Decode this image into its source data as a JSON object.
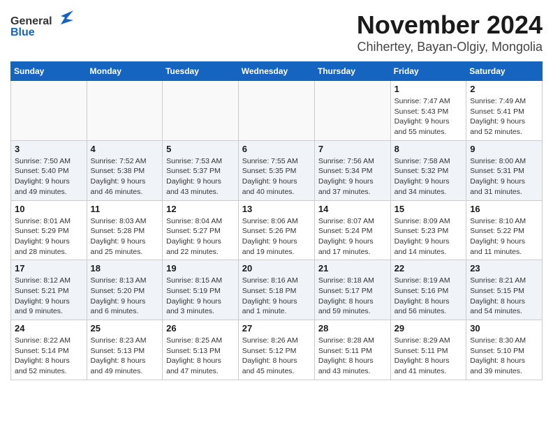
{
  "header": {
    "logo_general": "General",
    "logo_blue": "Blue",
    "month_title": "November 2024",
    "location": "Chihertey, Bayan-Olgiy, Mongolia"
  },
  "weekdays": [
    "Sunday",
    "Monday",
    "Tuesday",
    "Wednesday",
    "Thursday",
    "Friday",
    "Saturday"
  ],
  "weeks": [
    [
      {
        "day": "",
        "info": ""
      },
      {
        "day": "",
        "info": ""
      },
      {
        "day": "",
        "info": ""
      },
      {
        "day": "",
        "info": ""
      },
      {
        "day": "",
        "info": ""
      },
      {
        "day": "1",
        "info": "Sunrise: 7:47 AM\nSunset: 5:43 PM\nDaylight: 9 hours\nand 55 minutes."
      },
      {
        "day": "2",
        "info": "Sunrise: 7:49 AM\nSunset: 5:41 PM\nDaylight: 9 hours\nand 52 minutes."
      }
    ],
    [
      {
        "day": "3",
        "info": "Sunrise: 7:50 AM\nSunset: 5:40 PM\nDaylight: 9 hours\nand 49 minutes."
      },
      {
        "day": "4",
        "info": "Sunrise: 7:52 AM\nSunset: 5:38 PM\nDaylight: 9 hours\nand 46 minutes."
      },
      {
        "day": "5",
        "info": "Sunrise: 7:53 AM\nSunset: 5:37 PM\nDaylight: 9 hours\nand 43 minutes."
      },
      {
        "day": "6",
        "info": "Sunrise: 7:55 AM\nSunset: 5:35 PM\nDaylight: 9 hours\nand 40 minutes."
      },
      {
        "day": "7",
        "info": "Sunrise: 7:56 AM\nSunset: 5:34 PM\nDaylight: 9 hours\nand 37 minutes."
      },
      {
        "day": "8",
        "info": "Sunrise: 7:58 AM\nSunset: 5:32 PM\nDaylight: 9 hours\nand 34 minutes."
      },
      {
        "day": "9",
        "info": "Sunrise: 8:00 AM\nSunset: 5:31 PM\nDaylight: 9 hours\nand 31 minutes."
      }
    ],
    [
      {
        "day": "10",
        "info": "Sunrise: 8:01 AM\nSunset: 5:29 PM\nDaylight: 9 hours\nand 28 minutes."
      },
      {
        "day": "11",
        "info": "Sunrise: 8:03 AM\nSunset: 5:28 PM\nDaylight: 9 hours\nand 25 minutes."
      },
      {
        "day": "12",
        "info": "Sunrise: 8:04 AM\nSunset: 5:27 PM\nDaylight: 9 hours\nand 22 minutes."
      },
      {
        "day": "13",
        "info": "Sunrise: 8:06 AM\nSunset: 5:26 PM\nDaylight: 9 hours\nand 19 minutes."
      },
      {
        "day": "14",
        "info": "Sunrise: 8:07 AM\nSunset: 5:24 PM\nDaylight: 9 hours\nand 17 minutes."
      },
      {
        "day": "15",
        "info": "Sunrise: 8:09 AM\nSunset: 5:23 PM\nDaylight: 9 hours\nand 14 minutes."
      },
      {
        "day": "16",
        "info": "Sunrise: 8:10 AM\nSunset: 5:22 PM\nDaylight: 9 hours\nand 11 minutes."
      }
    ],
    [
      {
        "day": "17",
        "info": "Sunrise: 8:12 AM\nSunset: 5:21 PM\nDaylight: 9 hours\nand 9 minutes."
      },
      {
        "day": "18",
        "info": "Sunrise: 8:13 AM\nSunset: 5:20 PM\nDaylight: 9 hours\nand 6 minutes."
      },
      {
        "day": "19",
        "info": "Sunrise: 8:15 AM\nSunset: 5:19 PM\nDaylight: 9 hours\nand 3 minutes."
      },
      {
        "day": "20",
        "info": "Sunrise: 8:16 AM\nSunset: 5:18 PM\nDaylight: 9 hours\nand 1 minute."
      },
      {
        "day": "21",
        "info": "Sunrise: 8:18 AM\nSunset: 5:17 PM\nDaylight: 8 hours\nand 59 minutes."
      },
      {
        "day": "22",
        "info": "Sunrise: 8:19 AM\nSunset: 5:16 PM\nDaylight: 8 hours\nand 56 minutes."
      },
      {
        "day": "23",
        "info": "Sunrise: 8:21 AM\nSunset: 5:15 PM\nDaylight: 8 hours\nand 54 minutes."
      }
    ],
    [
      {
        "day": "24",
        "info": "Sunrise: 8:22 AM\nSunset: 5:14 PM\nDaylight: 8 hours\nand 52 minutes."
      },
      {
        "day": "25",
        "info": "Sunrise: 8:23 AM\nSunset: 5:13 PM\nDaylight: 8 hours\nand 49 minutes."
      },
      {
        "day": "26",
        "info": "Sunrise: 8:25 AM\nSunset: 5:13 PM\nDaylight: 8 hours\nand 47 minutes."
      },
      {
        "day": "27",
        "info": "Sunrise: 8:26 AM\nSunset: 5:12 PM\nDaylight: 8 hours\nand 45 minutes."
      },
      {
        "day": "28",
        "info": "Sunrise: 8:28 AM\nSunset: 5:11 PM\nDaylight: 8 hours\nand 43 minutes."
      },
      {
        "day": "29",
        "info": "Sunrise: 8:29 AM\nSunset: 5:11 PM\nDaylight: 8 hours\nand 41 minutes."
      },
      {
        "day": "30",
        "info": "Sunrise: 8:30 AM\nSunset: 5:10 PM\nDaylight: 8 hours\nand 39 minutes."
      }
    ]
  ]
}
